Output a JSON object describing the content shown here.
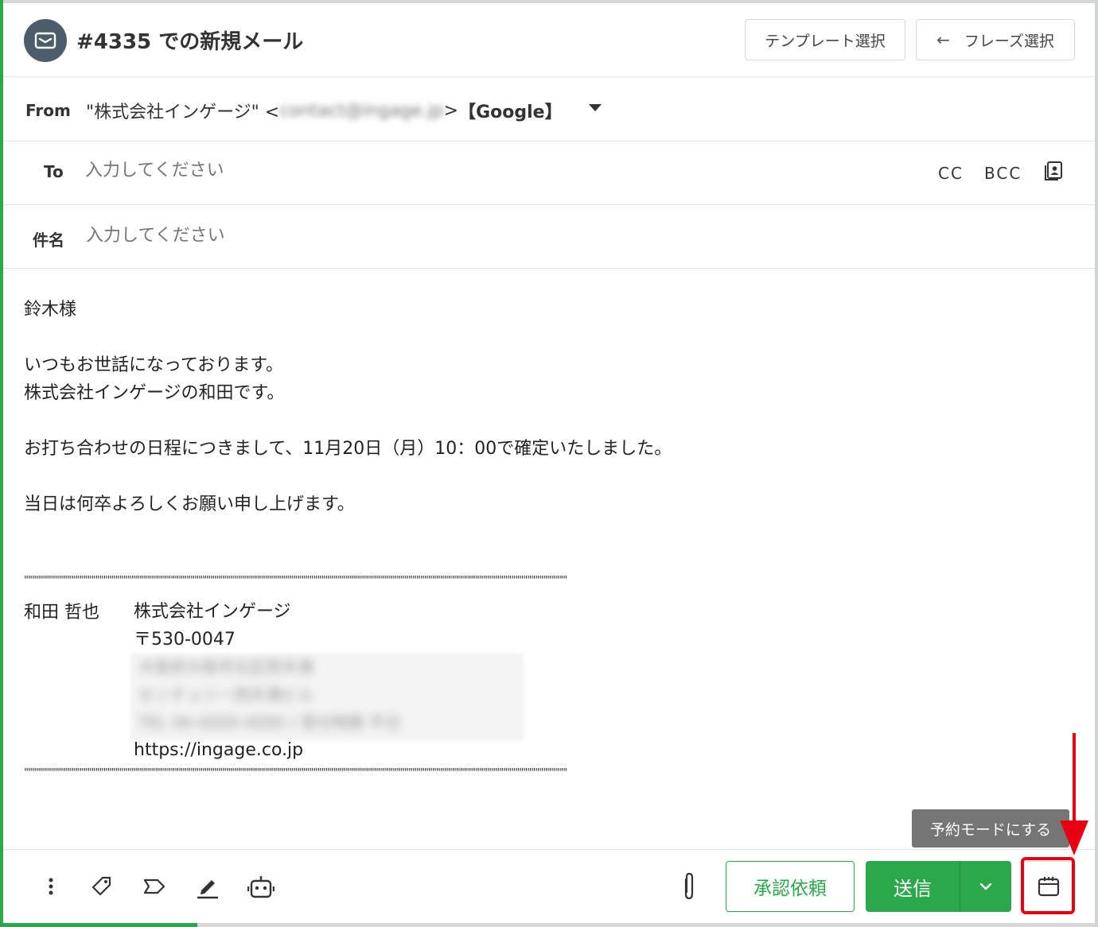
{
  "header": {
    "title": "#4335 での新規メール",
    "template_button": "テンプレート選択",
    "phrase_button": "フレーズ選択",
    "phrase_arrow_icon": "arrow-left-icon",
    "avatar_icon": "envelope-icon"
  },
  "from": {
    "label": "From",
    "name": "\"株式会社インゲージ\" <",
    "email_blurred": "contact@ingage.jp",
    "suffix": ">",
    "provider": "【Google】",
    "dropdown_icon": "caret-down-icon"
  },
  "to": {
    "label": "To",
    "placeholder": "入力してください",
    "cc_label": "CC",
    "bcc_label": "BCC",
    "address_book_icon": "address-book-icon"
  },
  "subject": {
    "label": "件名",
    "placeholder": "入力してください"
  },
  "body": {
    "greeting": "鈴木様",
    "line1": "いつもお世話になっております。",
    "line2": "株式会社インゲージの和田です。",
    "line3": "お打ち合わせの日程につきまして、11月20日（月）10：00で確定いたしました。",
    "line4": "当日は何卒よろしくお願い申し上げます。",
    "separator": "\"\"\"\"\"\"\"\"\"\"\"\"\"\"\"\"\"\"\"\"\"\"\"\"\"\"\"\"\"\"\"\"\"\"\"\"\"\"\"\"\"\"\"\"\"\"\"\"\"\"\"\"\"\"\"\"\"\"\"\"\"\"\"\"\"\"\"\"\"\"\"\"\"\"\"\"\"\"\"\"\"\"\"\"\"\"\"\"\"\"\"\"\"\"\"\"\"\"\"\"\"\"\"\"\"\"\"\"\"\"\"\"\"\"\"\"\"\"\"\"\"\"\"\"\"\"\"\"\"\"\"\"\"\"\"\"\"\"\"\"\"\"\"\"\"\"\"\"\"\"\"\"\"\"\"\"\"\"\"\"\"\"\"\"\"\"\"\"\"\"\"\"\"\"\"\"\"\"\"\"\"\"\"\"\"\"\"\"\"\"\"\"\"\"\"\"\"\"\"\"\"\"\"\"\"\"\"\"\"\"\"\"\"\"\"\"\"\"\"\"\"\"\"\"\"\"\"\"\"\"\"\"\"\"\"\"\"\"\"\"\"\"\"\"\"\"\""
  },
  "signature": {
    "name": "和田 哲也",
    "company": "株式会社インゲージ",
    "postal": "〒530-0047",
    "blurred_line1": "大阪府大阪市北区西天満",
    "blurred_line2": "センチュリー西天満ビル",
    "blurred_line3": "TEL 06-0000-0000 / 受付時間 平日",
    "url": "https://ingage.co.jp"
  },
  "tooltip": {
    "text": "予約モードにする"
  },
  "footer": {
    "more_icon": "more-vertical-icon",
    "tag_icon": "tag-icon",
    "label_icon": "label-icon",
    "signature_icon": "pen-icon",
    "ai_icon": "robot-icon",
    "attach_icon": "paperclip-icon",
    "approve_button": "承認依頼",
    "send_button": "送信",
    "send_dropdown_icon": "chevron-down-icon",
    "schedule_icon": "calendar-icon"
  },
  "colors": {
    "accent_green": "#2aa84a",
    "avatar_bg": "#4b5d6b",
    "highlight_red": "#e60012",
    "tooltip_bg": "#757575"
  }
}
